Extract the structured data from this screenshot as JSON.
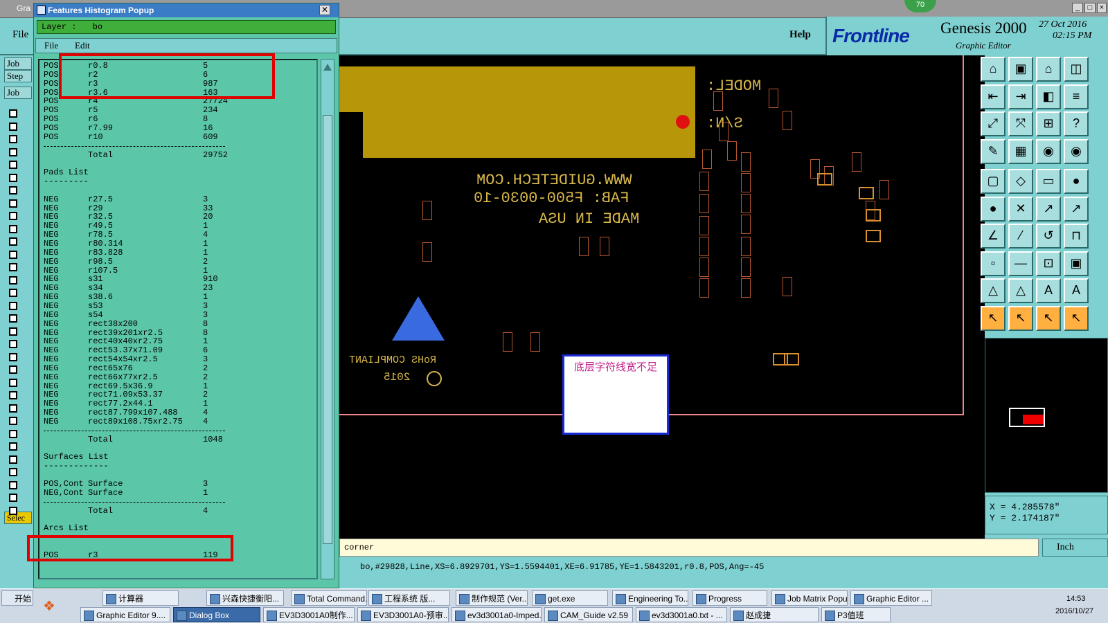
{
  "app": {
    "window_title": "Gra",
    "menu_help": "Help",
    "menu_file": "File",
    "logo": "Frontline",
    "product": "Genesis 2000",
    "product_sub": "Graphic Editor",
    "date": "27 Oct 2016",
    "time": "02:15 PM",
    "badge": "70"
  },
  "left_strip": {
    "job": "Job",
    "step": "Step",
    "job2": "Job",
    "select": "Selec"
  },
  "popup": {
    "title": "Features Histogram Popup",
    "layer_label": "Layer :",
    "layer_value": "bo",
    "menu": [
      "File",
      "Edit"
    ],
    "rows": [
      [
        "POS",
        "r0.8",
        "5"
      ],
      [
        "POS",
        "r2",
        "6"
      ],
      [
        "POS",
        "r3",
        "987"
      ],
      [
        "POS",
        "r3.6",
        "163"
      ],
      [
        "POS",
        "r4",
        "27724"
      ],
      [
        "POS",
        "r5",
        "234"
      ],
      [
        "POS",
        "r6",
        "8"
      ],
      [
        "POS",
        "r7.99",
        "16"
      ],
      [
        "POS",
        "r10",
        "609"
      ],
      [
        "sep",
        "",
        ""
      ],
      [
        "",
        "Total",
        "29752"
      ],
      [
        "",
        "",
        ""
      ],
      [
        "Pads List",
        "",
        ""
      ],
      [
        "---------",
        "",
        ""
      ],
      [
        "",
        "",
        ""
      ],
      [
        "NEG",
        "r27.5",
        "3"
      ],
      [
        "NEG",
        "r29",
        "33"
      ],
      [
        "NEG",
        "r32.5",
        "20"
      ],
      [
        "NEG",
        "r49.5",
        "1"
      ],
      [
        "NEG",
        "r78.5",
        "4"
      ],
      [
        "NEG",
        "r80.314",
        "1"
      ],
      [
        "NEG",
        "r83.828",
        "1"
      ],
      [
        "NEG",
        "r98.5",
        "2"
      ],
      [
        "NEG",
        "r107.5",
        "1"
      ],
      [
        "NEG",
        "s31",
        "910"
      ],
      [
        "NEG",
        "s34",
        "23"
      ],
      [
        "NEG",
        "s38.6",
        "1"
      ],
      [
        "NEG",
        "s53",
        "3"
      ],
      [
        "NEG",
        "s54",
        "3"
      ],
      [
        "NEG",
        "rect38x200",
        "8"
      ],
      [
        "NEG",
        "rect39x201xr2.5",
        "8"
      ],
      [
        "NEG",
        "rect40x40xr2.75",
        "1"
      ],
      [
        "NEG",
        "rect53.37x71.09",
        "6"
      ],
      [
        "NEG",
        "rect54x54xr2.5",
        "3"
      ],
      [
        "NEG",
        "rect65x76",
        "2"
      ],
      [
        "NEG",
        "rect66x77xr2.5",
        "2"
      ],
      [
        "NEG",
        "rect69.5x36.9",
        "1"
      ],
      [
        "NEG",
        "rect71.09x53.37",
        "2"
      ],
      [
        "NEG",
        "rect77.2x44.1",
        "1"
      ],
      [
        "NEG",
        "rect87.799x107.488",
        "4"
      ],
      [
        "NEG",
        "rect89x108.75xr2.75",
        "4"
      ],
      [
        "sep",
        "",
        ""
      ],
      [
        "",
        "Total",
        "1048"
      ],
      [
        "",
        "",
        ""
      ],
      [
        "Surfaces List",
        "",
        ""
      ],
      [
        "-------------",
        "",
        ""
      ],
      [
        "",
        "",
        ""
      ],
      [
        "POS,Cont",
        "Surface",
        "3"
      ],
      [
        "NEG,Cont",
        "Surface",
        "1"
      ],
      [
        "sep",
        "",
        ""
      ],
      [
        "",
        "Total",
        "4"
      ],
      [
        "",
        "",
        ""
      ],
      [
        "Arcs List",
        "",
        ""
      ],
      [
        "---------",
        "",
        ""
      ],
      [
        "",
        "",
        ""
      ],
      [
        "POS",
        "r3",
        "119"
      ]
    ]
  },
  "canvas": {
    "silk_model": "MODEL:",
    "silk_sn": "S/N:",
    "silk_line1": "WWW.GUIDETECH.COM",
    "silk_line2": "FAB: F500-0030-10",
    "silk_line3": "MADE IN USA",
    "silk_rohs": "RoHS COMPLIANT",
    "silk_year": "2015",
    "note": "底层字符线宽不足"
  },
  "coords": {
    "x": "X = 4.285578\"",
    "y": "Y = 2.174187\""
  },
  "command_field": "corner",
  "unit_label": "Inch",
  "status_line": "bo,#29828,Line,XS=6.8929701,YS=1.5594401,XE=6.91785,YE=1.5843201,r0.8,POS,Ang=-45",
  "taskbar": {
    "start": "开始",
    "row1": [
      "计算器",
      "兴森快捷衡阳...",
      "Total Command...",
      "工程系统  版...",
      "制作规范 (Ver...",
      "get.exe",
      "Engineering To...",
      "Progress",
      "Job Matrix Popup",
      "Graphic Editor ..."
    ],
    "row2": [
      "Graphic Editor 9....",
      "Dialog Box",
      "EV3D3001A0制作...",
      "EV3D3001A0-预审...",
      "ev3d3001a0-Imped...",
      "CAM_Guide v2.59",
      "ev3d3001a0.txt - ...",
      "赵成捷",
      "P3值班"
    ],
    "clock_time": "14:53",
    "clock_date": "2016/10/27"
  }
}
